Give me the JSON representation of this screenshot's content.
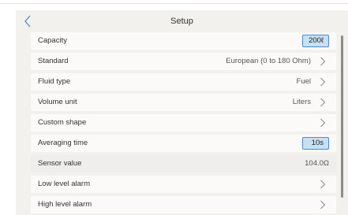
{
  "header": {
    "title": "Setup"
  },
  "rows": [
    {
      "label": "Capacity",
      "value": "200ℓ",
      "kind": "chip"
    },
    {
      "label": "Standard",
      "value": "European (0 to 180 Ohm)",
      "kind": "link"
    },
    {
      "label": "Fluid type",
      "value": "Fuel",
      "kind": "link"
    },
    {
      "label": "Volume unit",
      "value": "Liters",
      "kind": "link"
    },
    {
      "label": "Custom shape",
      "value": "",
      "kind": "link"
    },
    {
      "label": "Averaging time",
      "value": "10s",
      "kind": "chip"
    },
    {
      "label": "Sensor value",
      "value": "104.0Ω",
      "kind": "readonly"
    },
    {
      "label": "Low level alarm",
      "value": "",
      "kind": "link"
    },
    {
      "label": "High level alarm",
      "value": "",
      "kind": "link"
    }
  ],
  "colors": {
    "screen_bg": "#f2f1ee",
    "row_bg": "#fbfaf9",
    "accent": "#4a8bd0",
    "chip_bg": "#c9dff3"
  },
  "icons": {
    "back": "chevron-left-icon",
    "row_link": "chevron-right-icon"
  }
}
